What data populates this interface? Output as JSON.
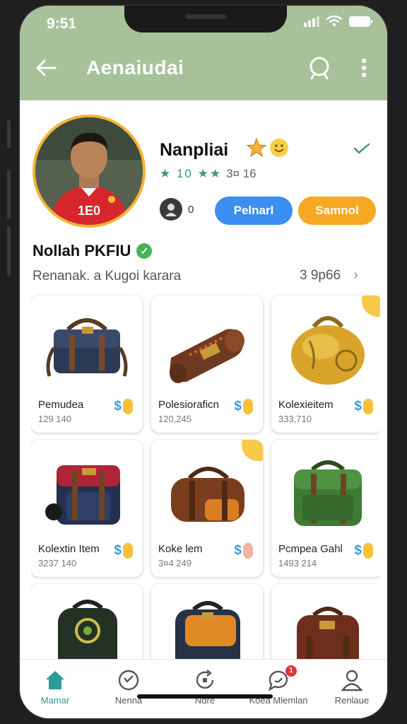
{
  "status_bar": {
    "time": "9:51"
  },
  "appbar": {
    "title": "Aenaiudai"
  },
  "profile": {
    "name": "Nanpliai",
    "rating_text": "3¤ 16",
    "rating_prefix": "★ 10 ★★",
    "follow_count": "0",
    "primary_button": "Pelnarl",
    "secondary_button": "Samnol",
    "shop_name": "Nollah PKFIU",
    "shop_desc": "Renanak. a Kugoi karara",
    "item_count": "3 9p66"
  },
  "items": [
    {
      "title": "Pemudea",
      "price": "129 140"
    },
    {
      "title": "Polesioraficn",
      "price": "120,245"
    },
    {
      "title": "Kolexieitem",
      "price": "333,710"
    },
    {
      "title": "Kolextin Item",
      "price": "3237 140"
    },
    {
      "title": "Koke lem",
      "price": "3¤4 249"
    },
    {
      "title": "Pcmpea Gahl",
      "price": "1493 214"
    },
    {
      "title": "",
      "price": ""
    },
    {
      "title": "",
      "price": ""
    },
    {
      "title": "",
      "price": ""
    }
  ],
  "tabs": [
    {
      "label": "Mamar",
      "icon": "home-icon"
    },
    {
      "label": "Nenna",
      "icon": "smile-icon"
    },
    {
      "label": "Ndre",
      "icon": "refresh-icon"
    },
    {
      "label": "Koea Mlemlan",
      "icon": "chat-icon",
      "badge": "1"
    },
    {
      "label": "Renlaue",
      "icon": "user-icon"
    }
  ],
  "colors": {
    "header": "#a7c29a",
    "primary_button": "#3c8ef0",
    "secondary_button": "#f7a823",
    "active_tab": "#2a9a9a",
    "rating_star": "#3f9a6a",
    "verified": "#43b35a"
  }
}
